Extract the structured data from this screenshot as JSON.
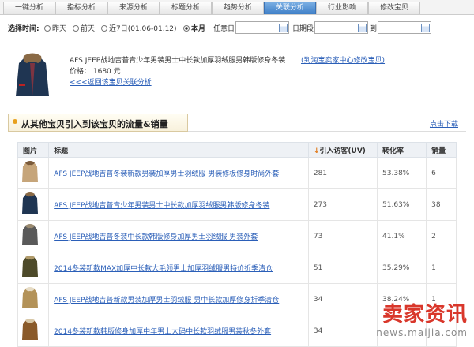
{
  "tabs": [
    {
      "label": "一键分析",
      "active": false
    },
    {
      "label": "指标分析",
      "active": false
    },
    {
      "label": "来源分析",
      "active": false
    },
    {
      "label": "标题分析",
      "active": false
    },
    {
      "label": "趋势分析",
      "active": false
    },
    {
      "label": "关联分析",
      "active": true
    },
    {
      "label": "行业影响",
      "active": false
    },
    {
      "label": "修改宝贝",
      "active": false
    }
  ],
  "timebar": {
    "label": "选择时间:",
    "options": [
      {
        "label": "昨天",
        "checked": false
      },
      {
        "label": "前天",
        "checked": false
      },
      {
        "label": "近7日(01.06-01.12)",
        "checked": false
      },
      {
        "label": "本月",
        "checked": true
      }
    ],
    "custom_label": "任意日",
    "range_label": "日期段",
    "to_label": "到"
  },
  "product": {
    "title": "AFS JEEP战地吉普青少年男装男士中长款加厚羽绒服男韩版修身冬装",
    "link": "(到淘宝卖家中心修改宝贝)",
    "price": "价格： 1680 元",
    "back": "<<<返回该宝贝关联分析"
  },
  "section": {
    "title": "从其他宝贝引入到该宝贝的流量&销量",
    "download": "点击下载"
  },
  "table": {
    "headers": [
      "图片",
      "标题",
      "引入访客(UV)",
      "转化率",
      "销量"
    ],
    "rows": [
      {
        "title": "AFS JEEP战地吉普冬装新款男装加厚男士羽绒服 男装修板修身时尚外套",
        "uv": "281",
        "rate": "53.38%",
        "sales": "6",
        "thumb": "tan"
      },
      {
        "title": "AFS JEEP战地吉普青少年男装男士中长款加厚羽绒服男韩版修身冬装",
        "uv": "273",
        "rate": "51.63%",
        "sales": "38",
        "thumb": "navy"
      },
      {
        "title": "AFS JEEP战地吉普冬装中长款韩版修身加厚男士羽绒服 男装外套",
        "uv": "73",
        "rate": "41.1%",
        "sales": "2",
        "thumb": "grey"
      },
      {
        "title": "2014冬装新款MAX加厚中长款大毛领男士加厚羽绒服男特价折季清仓",
        "uv": "51",
        "rate": "35.29%",
        "sales": "1",
        "thumb": "olive"
      },
      {
        "title": "AFS JEEP战地吉普新款男装加厚男士羽绒服 男中长款加厚修身折季清仓",
        "uv": "34",
        "rate": "38.24%",
        "sales": "1",
        "thumb": "khaki"
      },
      {
        "title": "2014冬装新款韩版修身加厚中年男士大码中长款羽绒服男装秋冬外套",
        "uv": "34",
        "rate": "",
        "sales": "",
        "thumb": "brown"
      }
    ]
  },
  "watermark": {
    "cn": "卖家资讯",
    "en": "news.maijia.com"
  },
  "colors": {
    "accent": "#2b5fb8",
    "active_tab": "#3f7fc7",
    "watermark": "#d9372b"
  }
}
